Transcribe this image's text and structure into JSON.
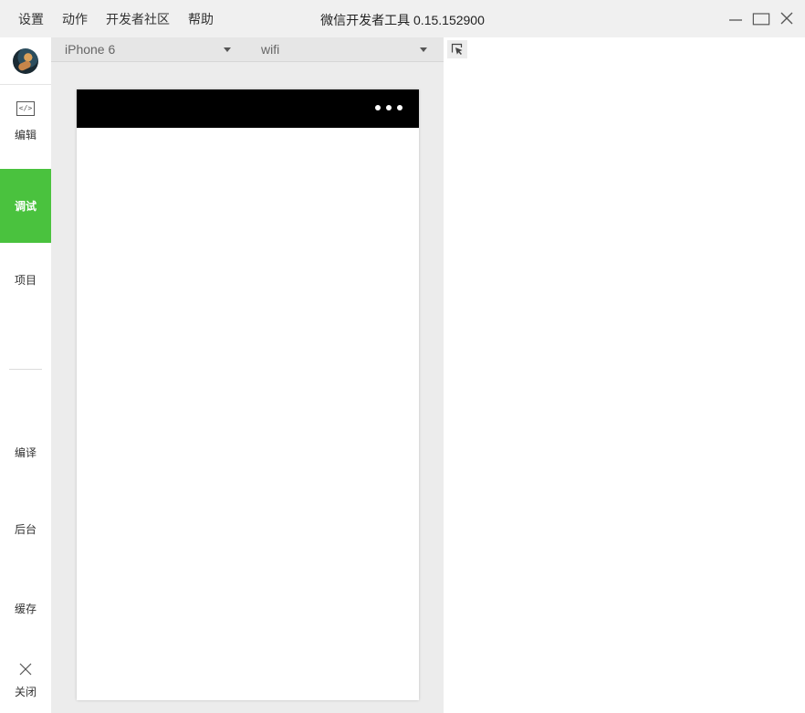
{
  "window": {
    "title": "微信开发者工具 0.15.152900",
    "menu": [
      "设置",
      "动作",
      "开发者社区",
      "帮助"
    ]
  },
  "sidebar": {
    "items": [
      {
        "label": "编辑",
        "icon": "code-icon"
      },
      {
        "label": "调试",
        "active": true
      },
      {
        "label": "项目"
      },
      {
        "label": "编译"
      },
      {
        "label": "后台"
      },
      {
        "label": "缓存"
      },
      {
        "label": "关闭",
        "icon": "close-icon"
      }
    ]
  },
  "simulator": {
    "device": "iPhone 6",
    "network": "wifi"
  },
  "colors": {
    "accent": "#4ac23e",
    "titlebar": "#f0f0f0",
    "phone_nav": "#000000"
  }
}
